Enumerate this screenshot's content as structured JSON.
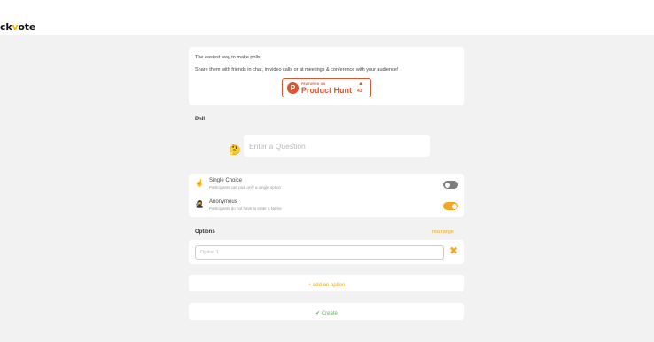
{
  "header": {
    "logo_prefix": "ck",
    "logo_check": "v",
    "logo_suffix": "ote"
  },
  "intro": {
    "line1": "The easiest way to make polls",
    "line2": "Share them with friends in chat, in video calls or at meetings & conference with your audience!"
  },
  "product_hunt": {
    "featured": "FEATURED ON",
    "name": "Product Hunt",
    "upvote_arrow": "▲",
    "upvotes": "43",
    "logo_letter": "P",
    "color": "#da552f"
  },
  "poll": {
    "label": "Poll",
    "question_placeholder": "Enter a Question",
    "question_icon": "thinking-face-icon"
  },
  "settings": [
    {
      "title": "Single Choice",
      "subtitle": "Participants can pick only a single option",
      "icon": "pointing-up-icon",
      "enabled": false
    },
    {
      "title": "Anonymous",
      "subtitle": "Participants do not have to enter a Name",
      "icon": "ninja-icon",
      "enabled": true
    }
  ],
  "options": {
    "label": "Options",
    "rearrange": "rearrange",
    "items": [
      {
        "placeholder": "Option 1",
        "value": ""
      }
    ],
    "remove_glyph": "✖"
  },
  "actions": {
    "add_option": "+ add an option",
    "create": "✔ Create"
  },
  "colors": {
    "accent": "#f5a623",
    "toggle_off": "#7d7d7d",
    "create": "#5cb85c",
    "background": "#f2f2f2"
  }
}
